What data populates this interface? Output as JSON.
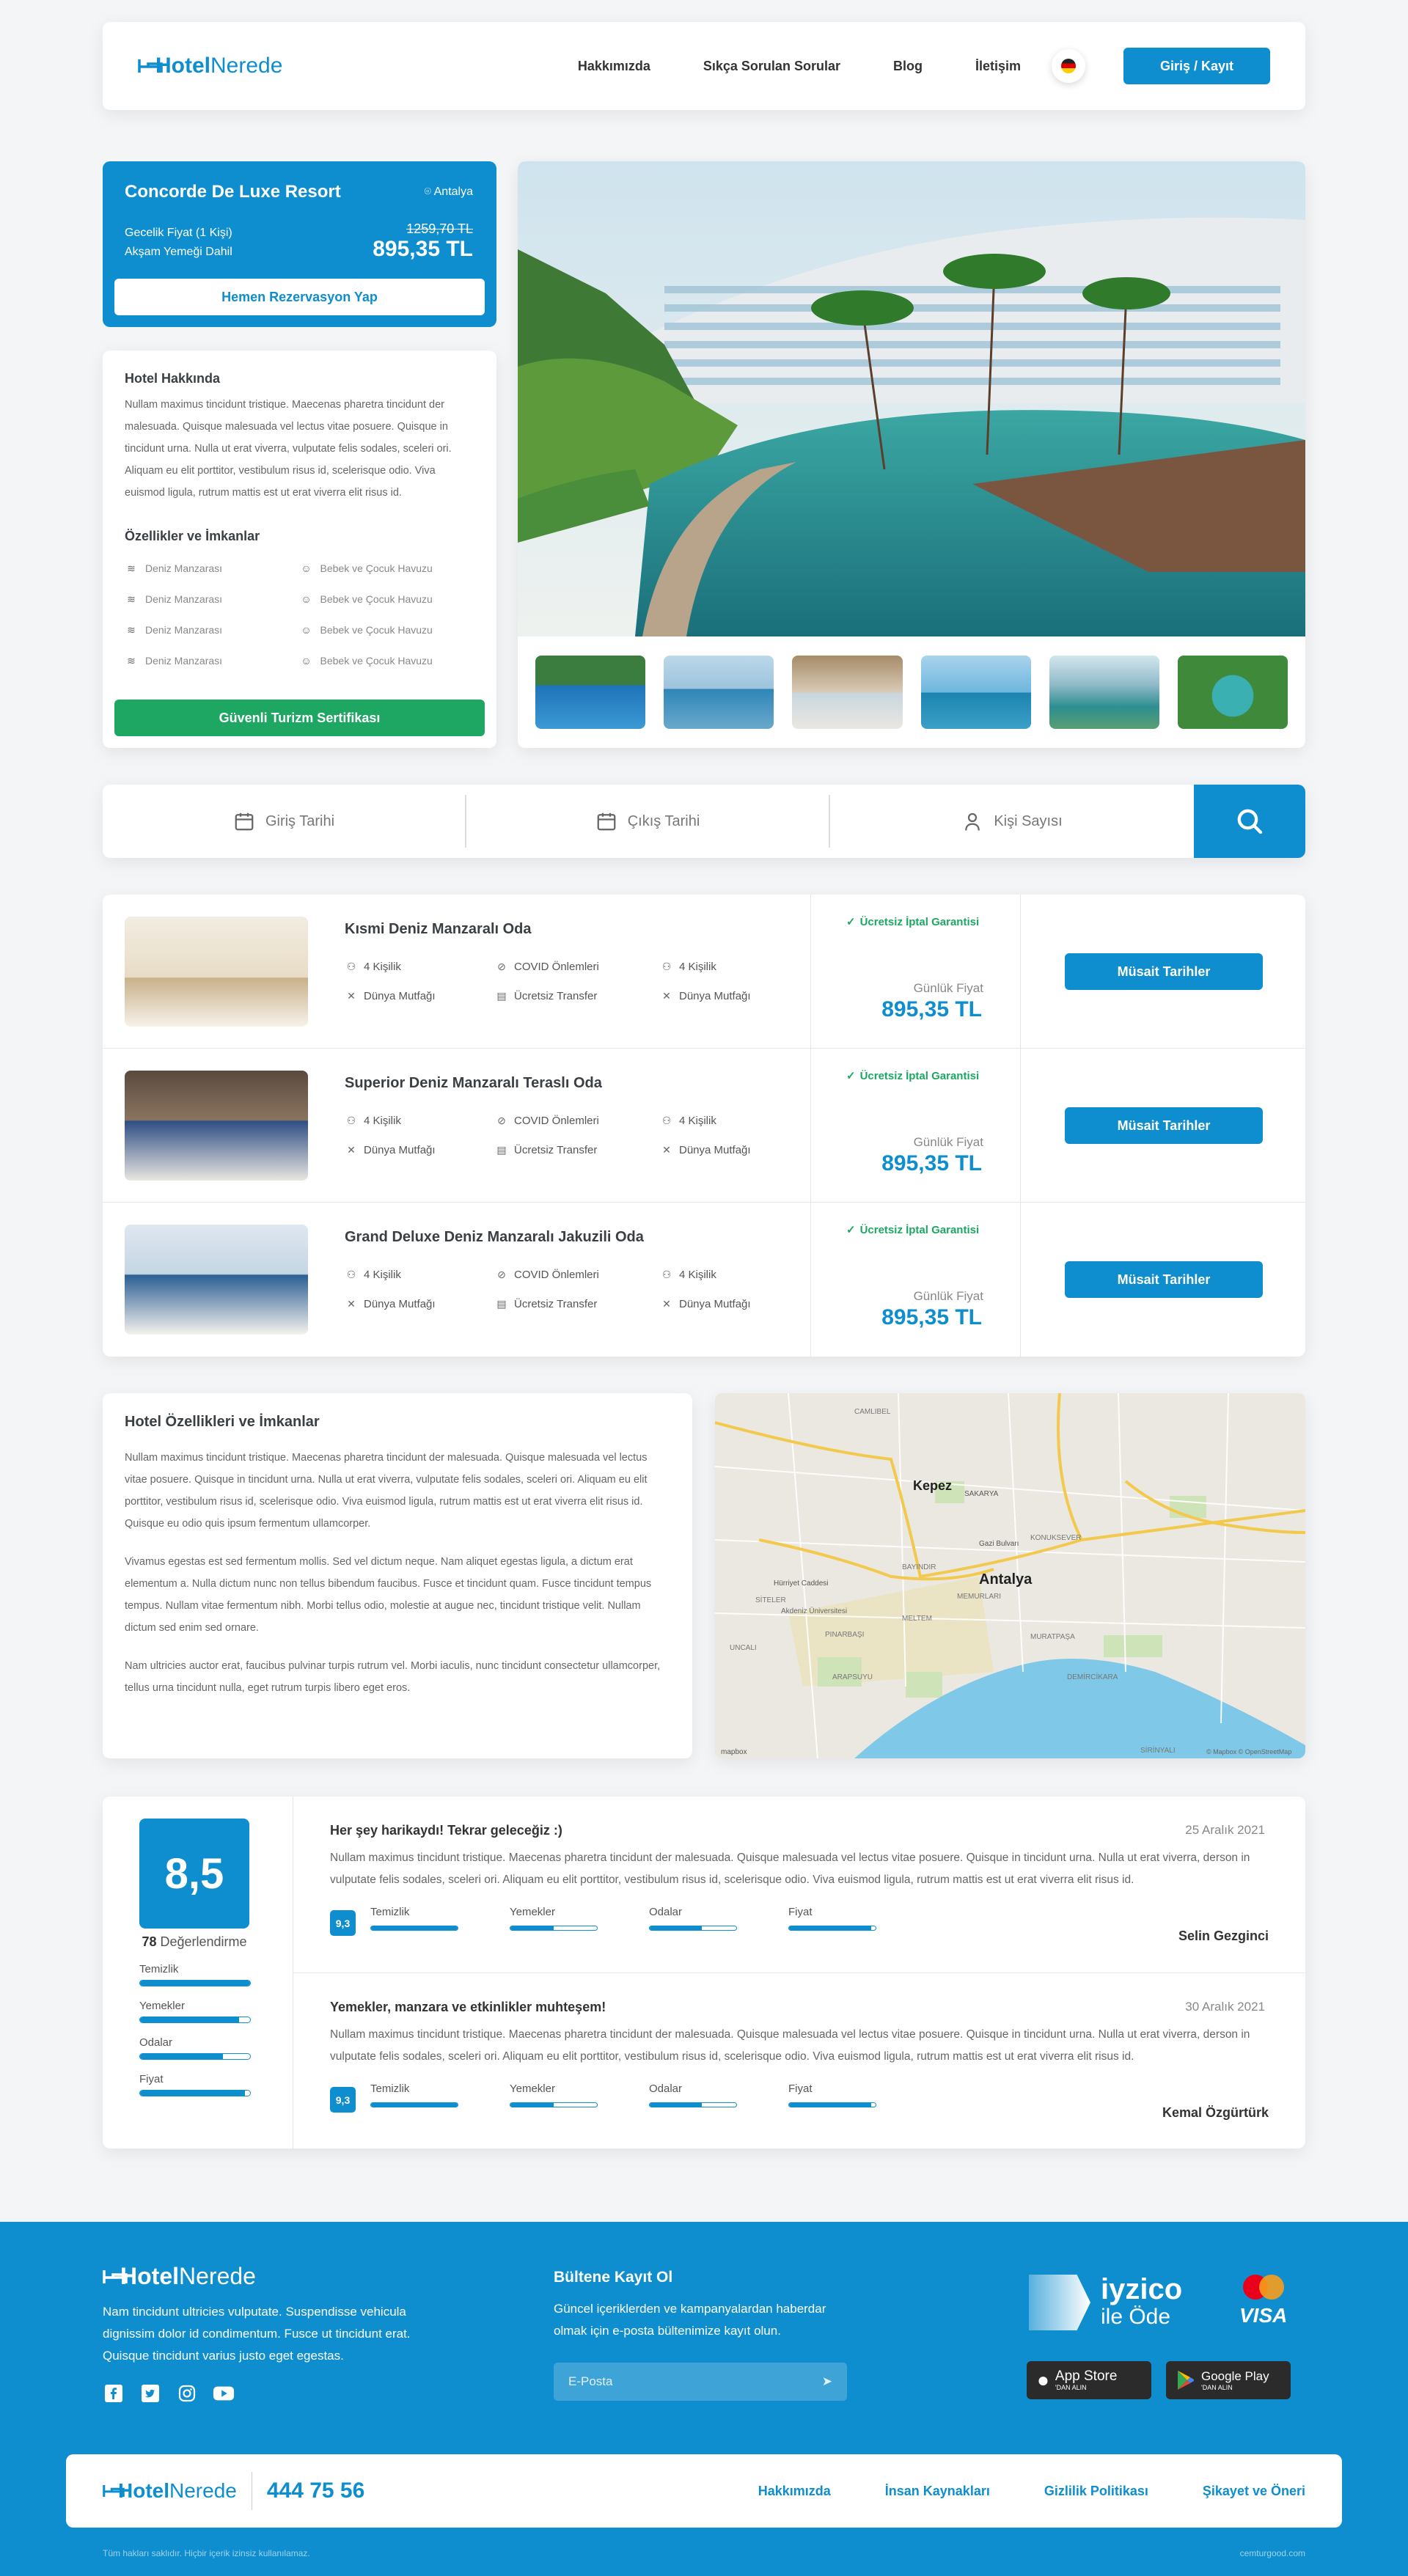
{
  "brand": {
    "logo_a": "Hotel",
    "logo_b": "Nerede"
  },
  "nav": {
    "items": [
      "Hakkımızda",
      "Sıkça Sorulan Sorular",
      "Blog",
      "İletişim"
    ],
    "login": "Giriş / Kayıt"
  },
  "hotel": {
    "name": "Concorde De Luxe Resort",
    "location": "Antalya",
    "price_label_1": "Gecelik Fiyat (1 Kişi)",
    "price_label_2": "Akşam Yemeği Dahil",
    "old_price": "1259,70 TL",
    "price": "895,35 TL",
    "reserve": "Hemen Rezervasyon Yap"
  },
  "about": {
    "title": "Hotel Hakkında",
    "text": "Nullam maximus tincidunt tristique. Maecenas pharetra tincidunt der malesuada. Quisque malesuada vel lectus vitae posuere. Quisque in tincidunt urna. Nulla ut erat viverra, vulputate felis sodales, sceleri ori. Aliquam eu elit porttitor, vestibulum risus id, scelerisque odio. Viva euismod ligula, rutrum mattis est ut erat viverra elit risus id.",
    "features_title": "Özellikler ve İmkanlar",
    "features": [
      "Deniz Manzarası",
      "Bebek ve Çocuk Havuzu",
      "Deniz Manzarası",
      "Bebek ve Çocuk Havuzu",
      "Deniz Manzarası",
      "Bebek ve Çocuk Havuzu",
      "Deniz Manzarası",
      "Bebek ve Çocuk Havuzu"
    ],
    "cert": "Güvenli Turizm Sertifikası"
  },
  "search": {
    "checkin": "Giriş Tarihi",
    "checkout": "Çıkış Tarihi",
    "guests": "Kişi Sayısı"
  },
  "rooms": [
    {
      "title": "Kısmi Deniz Manzaralı Oda",
      "f1": "4 Kişilik",
      "f2": "COVID Önlemleri",
      "f3": "4 Kişilik",
      "f4": "Dünya Mutfağı",
      "f5": "Ücretsiz Transfer",
      "f6": "Dünya Mutfağı",
      "guarantee": "Ücretsiz İptal Garantisi",
      "price_label": "Günlük Fiyat",
      "price": "895,35 TL",
      "button": "Müsait Tarihler"
    },
    {
      "title": "Superior Deniz Manzaralı Teraslı Oda",
      "f1": "4 Kişilik",
      "f2": "COVID Önlemleri",
      "f3": "4 Kişilik",
      "f4": "Dünya Mutfağı",
      "f5": "Ücretsiz Transfer",
      "f6": "Dünya Mutfağı",
      "guarantee": "Ücretsiz İptal Garantisi",
      "price_label": "Günlük Fiyat",
      "price": "895,35 TL",
      "button": "Müsait Tarihler"
    },
    {
      "title": "Grand Deluxe Deniz Manzaralı Jakuzili Oda",
      "f1": "4 Kişilik",
      "f2": "COVID Önlemleri",
      "f3": "4 Kişilik",
      "f4": "Dünya Mutfağı",
      "f5": "Ücretsiz Transfer",
      "f6": "Dünya Mutfağı",
      "guarantee": "Ücretsiz İptal Garantisi",
      "price_label": "Günlük Fiyat",
      "price": "895,35 TL",
      "button": "Müsait Tarihler"
    }
  ],
  "hotel_features": {
    "title": "Hotel Özellikleri ve İmkanlar",
    "p1": "Nullam maximus tincidunt tristique. Maecenas pharetra tincidunt der malesuada. Quisque malesuada vel lectus vitae posuere. Quisque in tincidunt urna. Nulla ut erat viverra, vulputate felis sodales, sceleri ori. Aliquam eu elit porttitor, vestibulum risus id, scelerisque odio. Viva euismod ligula, rutrum mattis est ut erat viverra elit risus id. Quisque eu odio quis ipsum fermentum ullamcorper.",
    "p2": "Vivamus egestas est sed fermentum mollis. Sed vel dictum neque. Nam aliquet egestas ligula, a dictum erat elementum a. Nulla dictum nunc non tellus bibendum faucibus. Fusce et tincidunt quam. Fusce tincidunt tempus tempus. Nullam vitae fermentum nibh. Morbi tellus odio, molestie at augue nec, tincidunt tristique velit. Nullam dictum sed enim sed ornare.",
    "p3": "Nam ultricies auctor erat, faucibus pulvinar turpis rutrum vel. Morbi iaculis, nunc tincidunt consectetur ullamcorper, tellus urna tincidunt nulla, eget rutrum turpis libero eget eros."
  },
  "map": {
    "labels": [
      "Kepez",
      "Antalya",
      "CAMLIBEL",
      "SAKARYA",
      "Gazi Bulvarı",
      "KONUKSEVER",
      "MEMURLARI",
      "MELTEM",
      "SİTELER",
      "Akdeniz Üniversitesi",
      "PINARBAŞI",
      "UNCALI",
      "ARAPSUYU",
      "MURATPAŞA",
      "DEMİRCİKARA",
      "SİRİNYALI",
      "Hürriyet Caddesi",
      "BAYINDIR"
    ],
    "attribution": "© Mapbox © OpenStreetMap",
    "mapbox": "mapbox"
  },
  "reviews": {
    "score": "8,5",
    "count": "78",
    "count_label": "Değerlendirme",
    "categories": [
      {
        "name": "Temizlik",
        "value": 1.0
      },
      {
        "name": "Yemekler",
        "value": 0.9
      },
      {
        "name": "Odalar",
        "value": 0.75
      },
      {
        "name": "Fiyat",
        "value": 0.95
      }
    ],
    "items": [
      {
        "title": "Her şey harikaydı! Tekrar geleceğiz :)",
        "date": "25 Aralık 2021",
        "text": "Nullam maximus tincidunt tristique. Maecenas pharetra tincidunt der malesuada. Quisque malesuada vel lectus vitae posuere. Quisque in tincidunt urna. Nulla ut  erat viverra, derson in vulputate felis sodales, sceleri ori. Aliquam eu elit porttitor, vestibulum risus id, scelerisque odio. Viva euismod ligula, rutrum mattis est ut erat viverra elit risus id.",
        "score": "9,3",
        "bars": [
          {
            "name": "Temizlik",
            "value": 1.0
          },
          {
            "name": "Yemekler",
            "value": 0.5
          },
          {
            "name": "Odalar",
            "value": 0.6
          },
          {
            "name": "Fiyat",
            "value": 0.95
          }
        ],
        "author": "Selin Gezginci"
      },
      {
        "title": "Yemekler, manzara ve etkinlikler muhteşem!",
        "date": "30 Aralık 2021",
        "text": "Nullam maximus tincidunt tristique. Maecenas pharetra tincidunt der malesuada. Quisque malesuada vel lectus vitae posuere. Quisque in tincidunt urna. Nulla ut  erat viverra, derson in vulputate felis sodales, sceleri ori. Aliquam eu elit porttitor, vestibulum risus id, scelerisque odio. Viva euismod ligula, rutrum mattis est ut erat viverra elit risus id.",
        "score": "9,3",
        "bars": [
          {
            "name": "Temizlik",
            "value": 1.0
          },
          {
            "name": "Yemekler",
            "value": 0.5
          },
          {
            "name": "Odalar",
            "value": 0.6
          },
          {
            "name": "Fiyat",
            "value": 0.95
          }
        ],
        "author": "Kemal Özgürtürk"
      }
    ]
  },
  "footer": {
    "text": "Nam tincidunt ultricies vulputate. Suspendisse vehicula dignissim dolor id condimentum. Fusce ut tincidunt erat. Quisque tincidunt varius justo eget egestas.",
    "newsletter_title": "Bültene Kayıt Ol",
    "newsletter_text": "Güncel içeriklerden ve kampanyalardan haberdar olmak için e-posta bültenimize kayıt olun.",
    "email_placeholder": "E-Posta",
    "iyzico_a": "iyzico",
    "iyzico_b": "ile Öde",
    "visa": "VISA",
    "appstore_small": "'DAN ALIN",
    "appstore": "App Store",
    "playstore_small": "'DAN ALIN",
    "playstore": "Google Play",
    "phone": "444 75 56",
    "links": [
      "Hakkımızda",
      "İnsan Kaynakları",
      "Gizlilik Politikası",
      "Şikayet ve Öneri"
    ],
    "copyright": "Tüm hakları saklıdır. Hiçbir içerik izinsiz kullanılamaz.",
    "credit": "cemturgood.com"
  },
  "colors": {
    "primary": "#0e8ecf",
    "green": "#1ea763"
  }
}
